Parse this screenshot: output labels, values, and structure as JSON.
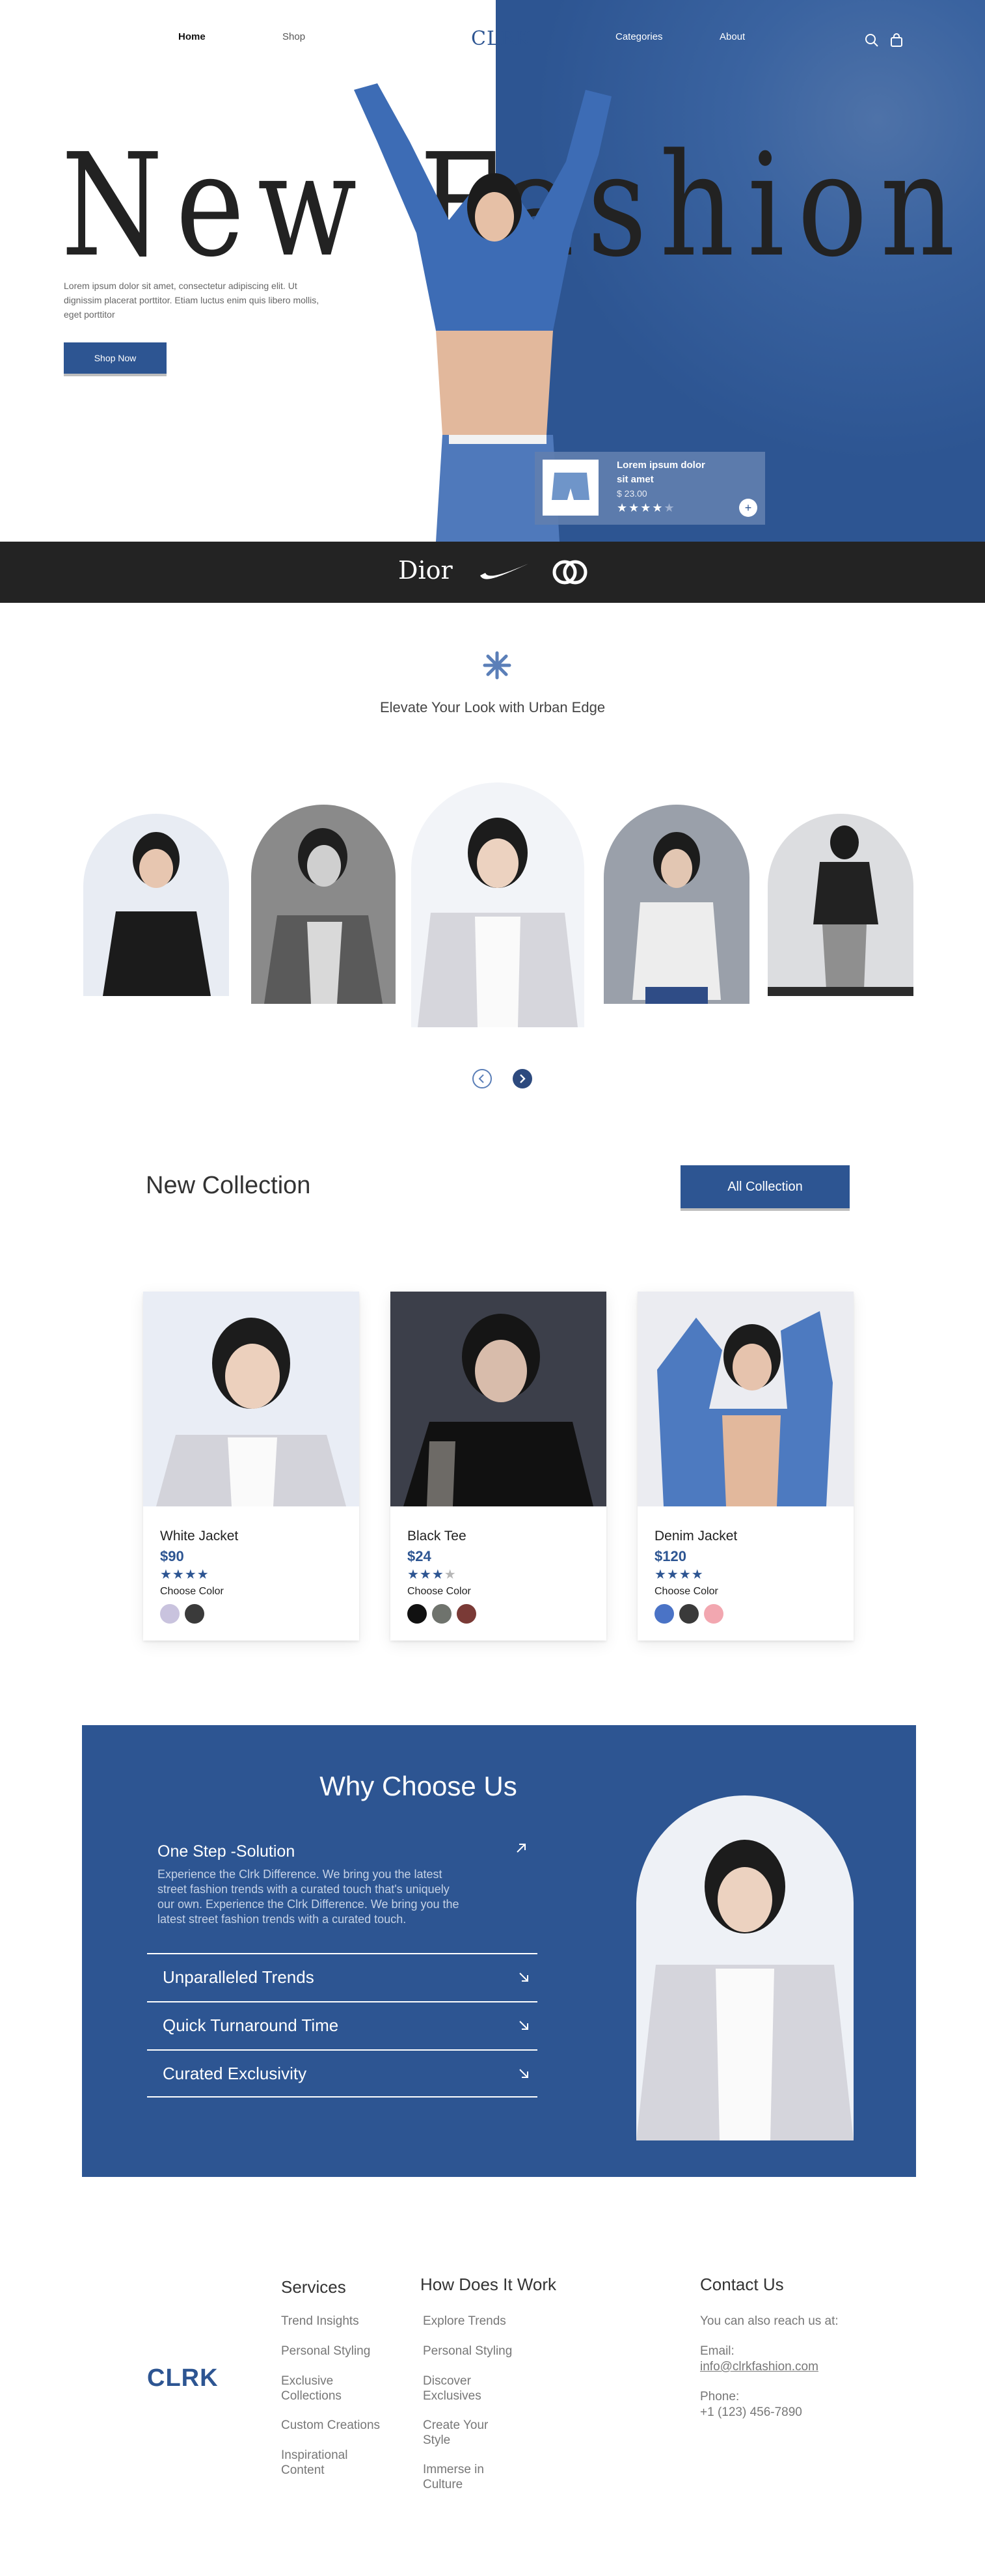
{
  "nav": {
    "home": "Home",
    "shop": "Shop",
    "logo": "CLRK",
    "categories": "Categories",
    "about": "About"
  },
  "hero": {
    "headline": "New Fashion",
    "body": "Lorem ipsum dolor sit amet, consectetur adipiscing elit. Ut dignissim placerat porttitor. Etiam luctus enim quis libero mollis, eget porttitor",
    "cta": "Shop Now",
    "product": {
      "name": "Lorem ipsum dolor sit amet",
      "price": "$ 23.00",
      "rating": 4,
      "stars": "★★★★★"
    }
  },
  "brands": {
    "dior": "Dior"
  },
  "tagline": "Elevate Your Look with Urban Edge",
  "collection": {
    "title": "New Collection",
    "cta": "All Collection",
    "choose_label": "Choose Color",
    "items": [
      {
        "name": "White Jacket",
        "price": "$90",
        "stars": "★★★★",
        "colors": [
          "#c9c3de",
          "#3a3a3a"
        ]
      },
      {
        "name": "Black Tee",
        "price": "$24",
        "stars": "★★★★",
        "rating": 3,
        "colors": [
          "#111111",
          "#6f736d",
          "#7a3a36"
        ]
      },
      {
        "name": "Denim Jacket",
        "price": "$120",
        "stars": "★★★★",
        "colors": [
          "#4a73c6",
          "#3a3a3a",
          "#f2a7b0"
        ]
      }
    ]
  },
  "why": {
    "title": "Why Choose Us",
    "open": {
      "title": "One Step -Solution",
      "text": "Experience the Clrk Difference. We bring you the latest street fashion trends with a curated touch that's uniquely our own. Experience the Clrk Difference. We bring you the latest street fashion trends with a curated touch."
    },
    "items": [
      "Unparalleled Trends",
      "Quick Turnaround Time",
      "Curated Exclusivity"
    ]
  },
  "footer": {
    "logo": "CLRK",
    "services": {
      "title": "Services",
      "links": [
        "Trend Insights",
        "Personal Styling",
        "Exclusive Collections",
        "Custom Creations",
        "Inspirational Content"
      ]
    },
    "how": {
      "title": "How  Does It Work",
      "links": [
        "Explore Trends",
        "Personal Styling",
        "Discover Exclusives",
        "Create Your Style",
        "Immerse in Culture"
      ]
    },
    "contact": {
      "title": "Contact Us",
      "intro": "You can also reach us at:",
      "email_label": "Email:",
      "email": "info@clrkfashion.com",
      "phone_label": "Phone:",
      "phone": "+1 (123) 456-7890"
    }
  },
  "colors": {
    "accent": "#2d5592",
    "dark": "#232323"
  }
}
